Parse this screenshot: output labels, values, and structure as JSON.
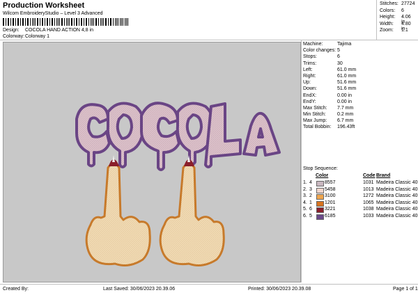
{
  "header": {
    "title": "Production Worksheet",
    "subtitle": "Wilcom EmbroideryStudio – Level 3 Advanced"
  },
  "design": {
    "design_label": "Design:",
    "design_value": "COCOLA HAND ACTION 4,8 in",
    "colorway_label": "Colorway:",
    "colorway_value": "Colorway 1"
  },
  "stats": [
    {
      "k": "Stitches:",
      "v": "27724"
    },
    {
      "k": "Colors:",
      "v": "6"
    },
    {
      "k": "Height:",
      "v": "4.06 in"
    },
    {
      "k": "Width:",
      "v": "4.80 in"
    },
    {
      "k": "Zoom:",
      "v": "1:1"
    }
  ],
  "machine": [
    {
      "k": "Machine:",
      "v": "Tajima"
    },
    {
      "k": "Color changes:",
      "v": "5"
    },
    {
      "k": "Stops:",
      "v": "6"
    },
    {
      "k": "Trims:",
      "v": "30"
    },
    {
      "k": "Left:",
      "v": "61.0 mm"
    },
    {
      "k": "Right:",
      "v": "61.0 mm"
    },
    {
      "k": "Up:",
      "v": "51.6 mm"
    },
    {
      "k": "Down:",
      "v": "51.6 mm"
    },
    {
      "k": "EndX:",
      "v": "0.00 in"
    },
    {
      "k": "EndY:",
      "v": "0.00 in"
    },
    {
      "k": "Max Stitch:",
      "v": "7.7 mm"
    },
    {
      "k": "Min Stitch:",
      "v": "0.2 mm"
    },
    {
      "k": "Max Jump:",
      "v": "6.7 mm"
    },
    {
      "k": "Total Bobbin:",
      "v": "196.43ft"
    }
  ],
  "stop_sequence": {
    "title": "Stop Sequence:",
    "headers": {
      "color": "Color",
      "code": "Code",
      "brand": "Brand"
    },
    "rows": [
      {
        "n": "1.",
        "idx": "4",
        "color": "8557",
        "swatch": "#c9b8c0",
        "code": "1031",
        "brand": "Madeira Classic 40"
      },
      {
        "n": "2.",
        "idx": "3",
        "color": "5458",
        "swatch": "#f0d6cc",
        "code": "1013",
        "brand": "Madeira Classic 40"
      },
      {
        "n": "3.",
        "idx": "2",
        "color": "3100",
        "swatch": "#f0a64e",
        "code": "1272",
        "brand": "Madeira Classic 40"
      },
      {
        "n": "4.",
        "idx": "1",
        "color": "1201",
        "swatch": "#d8741f",
        "code": "1065",
        "brand": "Madeira Classic 40"
      },
      {
        "n": "5.",
        "idx": "6",
        "color": "3221",
        "swatch": "#8a1e2a",
        "code": "1038",
        "brand": "Madeira Classic 40"
      },
      {
        "n": "6.",
        "idx": "5",
        "color": "6185",
        "swatch": "#6b4a8a",
        "code": "1033",
        "brand": "Madeira Classic 40"
      }
    ]
  },
  "artwork": {
    "text": "COCOLA"
  },
  "footer": {
    "created": "Created By:",
    "saved": "Last Saved: 30/06/2023 20.39.06",
    "printed": "Printed: 30/06/2023 20.39.08",
    "page": "Page 1 of 1"
  },
  "colors": {
    "canvas": "#c8c8c8",
    "letter_fill": "#ddbfc9",
    "letter_outline": "#6a4585",
    "hand_fill": "#f0d9b0",
    "hand_outline": "#c77a2b",
    "nail": "#8a1e2a"
  }
}
